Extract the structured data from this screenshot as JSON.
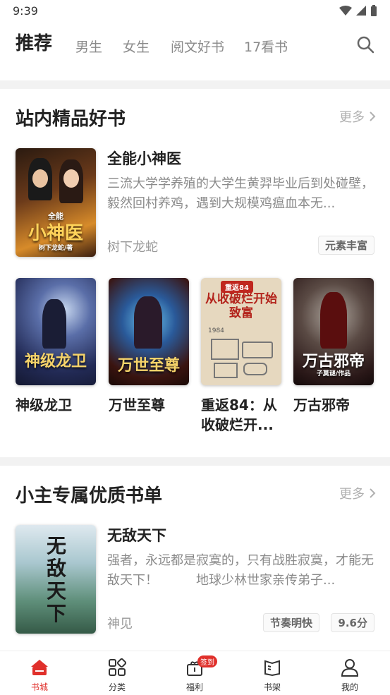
{
  "status": {
    "time": "9:39"
  },
  "nav": {
    "tabs": [
      {
        "label": "推荐"
      },
      {
        "label": "男生"
      },
      {
        "label": "女生"
      },
      {
        "label": "阅文好书"
      },
      {
        "label": "17看书"
      }
    ]
  },
  "section1": {
    "title": "站内精品好书",
    "more": "更多",
    "featured": {
      "title": "全能小神医",
      "desc": "三流大学学养殖的大学生黄羿毕业后到处碰壁，毅然回村养鸡，遇到大规模鸡瘟血本无...",
      "author": "树下龙蛇",
      "tag": "元素丰富",
      "cover_text": "小神医",
      "cover_sub": "全能",
      "cover_author": "树下龙蛇/著"
    },
    "grid": [
      {
        "title": "神级龙卫",
        "cover_text": "神级龙卫"
      },
      {
        "title": "万世至尊",
        "cover_text": "万世至尊"
      },
      {
        "title": "重返84：从收破烂开...",
        "cover_text": "从收破烂开始致富",
        "cover_top": "重返84",
        "cover_year": "1984"
      },
      {
        "title": "万古邪帝",
        "cover_text": "万古邪帝",
        "cover_sub": "子莫谜/作品"
      }
    ]
  },
  "section2": {
    "title": "小主专属优质书单",
    "more": "更多",
    "featured": {
      "title": "无敌天下",
      "desc": "强者，永远都是寂寞的，只有战胜寂寞，才能无敌天下！　　　地球少林世家亲传弟子...",
      "author": "神见",
      "tags": [
        "节奏明快",
        "9.6分"
      ],
      "cover_text": "无敌天下"
    }
  },
  "bottom": {
    "items": [
      {
        "label": "书城"
      },
      {
        "label": "分类"
      },
      {
        "label": "福利",
        "badge": "签到"
      },
      {
        "label": "书架"
      },
      {
        "label": "我的"
      }
    ]
  },
  "colors": {
    "accent": "#e0302b",
    "muted": "#8a8a8a"
  }
}
